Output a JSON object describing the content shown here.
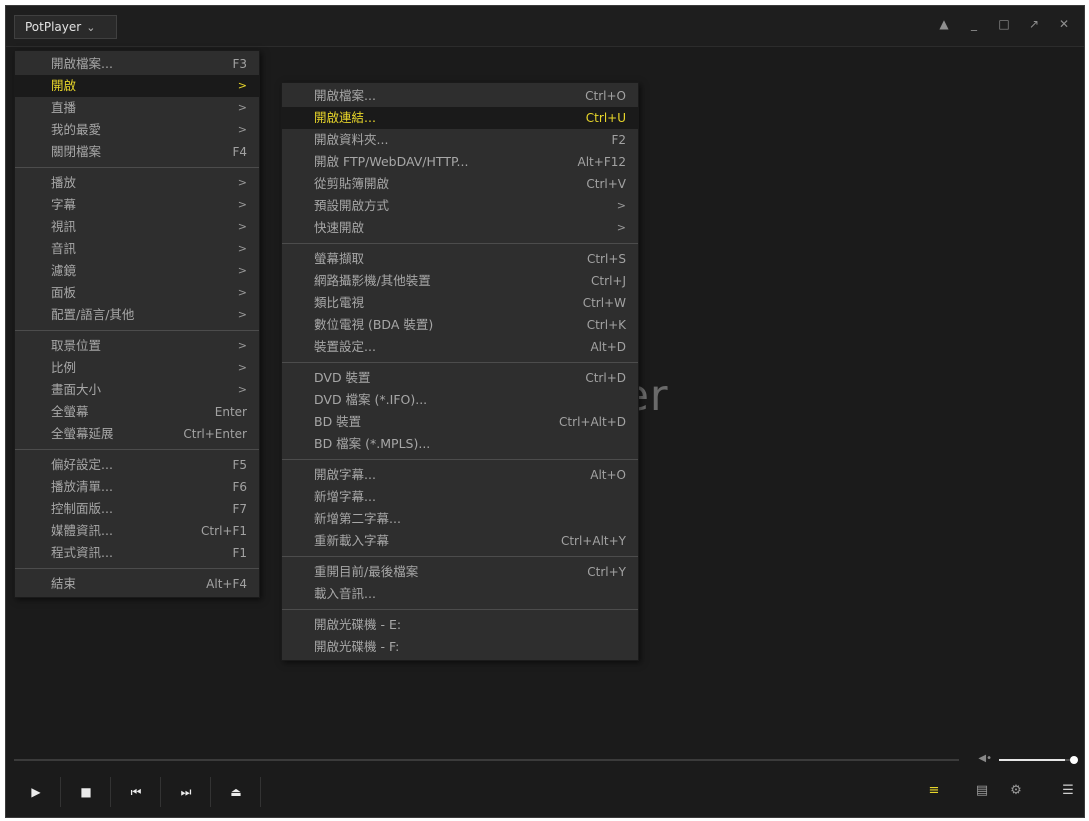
{
  "title_bar": {
    "app_menu_label": "PotPlayer",
    "window_controls": [
      "pin-icon",
      "minimize-icon",
      "maximize-icon",
      "fullscreen-icon",
      "close-icon"
    ]
  },
  "video": {
    "logo_text": "yer"
  },
  "main_menu": {
    "groups": [
      [
        {
          "label": "開啟檔案...",
          "shortcut": "F3",
          "submenu": false,
          "active": false
        },
        {
          "label": "開啟",
          "shortcut": "",
          "submenu": true,
          "active": true
        },
        {
          "label": "直播",
          "shortcut": "",
          "submenu": true,
          "active": false
        },
        {
          "label": "我的最愛",
          "shortcut": "",
          "submenu": true,
          "active": false
        },
        {
          "label": "關閉檔案",
          "shortcut": "F4",
          "submenu": false,
          "active": false
        }
      ],
      [
        {
          "label": "播放",
          "shortcut": "",
          "submenu": true,
          "active": false
        },
        {
          "label": "字幕",
          "shortcut": "",
          "submenu": true,
          "active": false
        },
        {
          "label": "視訊",
          "shortcut": "",
          "submenu": true,
          "active": false
        },
        {
          "label": "音訊",
          "shortcut": "",
          "submenu": true,
          "active": false
        },
        {
          "label": "濾鏡",
          "shortcut": "",
          "submenu": true,
          "active": false
        },
        {
          "label": "面板",
          "shortcut": "",
          "submenu": true,
          "active": false
        },
        {
          "label": "配置/語言/其他",
          "shortcut": "",
          "submenu": true,
          "active": false
        }
      ],
      [
        {
          "label": "取景位置",
          "shortcut": "",
          "submenu": true,
          "active": false
        },
        {
          "label": "比例",
          "shortcut": "",
          "submenu": true,
          "active": false
        },
        {
          "label": "畫面大小",
          "shortcut": "",
          "submenu": true,
          "active": false
        },
        {
          "label": "全螢幕",
          "shortcut": "Enter",
          "submenu": false,
          "active": false
        },
        {
          "label": "全螢幕延展",
          "shortcut": "Ctrl+Enter",
          "submenu": false,
          "active": false
        }
      ],
      [
        {
          "label": "偏好設定...",
          "shortcut": "F5",
          "submenu": false,
          "active": false
        },
        {
          "label": "播放清單...",
          "shortcut": "F6",
          "submenu": false,
          "active": false
        },
        {
          "label": "控制面版...",
          "shortcut": "F7",
          "submenu": false,
          "active": false
        },
        {
          "label": "媒體資訊...",
          "shortcut": "Ctrl+F1",
          "submenu": false,
          "active": false
        },
        {
          "label": "程式資訊...",
          "shortcut": "F1",
          "submenu": false,
          "active": false
        }
      ],
      [
        {
          "label": "結束",
          "shortcut": "Alt+F4",
          "submenu": false,
          "active": false
        }
      ]
    ]
  },
  "open_submenu": {
    "groups": [
      [
        {
          "label": "開啟檔案...",
          "shortcut": "Ctrl+O",
          "submenu": false,
          "active": false
        },
        {
          "label": "開啟連結...",
          "shortcut": "Ctrl+U",
          "submenu": false,
          "active": true
        },
        {
          "label": "開啟資料夾...",
          "shortcut": "F2",
          "submenu": false,
          "active": false
        },
        {
          "label": "開啟 FTP/WebDAV/HTTP...",
          "shortcut": "Alt+F12",
          "submenu": false,
          "active": false
        },
        {
          "label": "從剪貼簿開啟",
          "shortcut": "Ctrl+V",
          "submenu": false,
          "active": false
        },
        {
          "label": "預設開啟方式",
          "shortcut": "",
          "submenu": true,
          "active": false
        },
        {
          "label": "快速開啟",
          "shortcut": "",
          "submenu": true,
          "active": false
        }
      ],
      [
        {
          "label": "螢幕擷取",
          "shortcut": "Ctrl+S",
          "submenu": false,
          "active": false
        },
        {
          "label": "網路攝影機/其他裝置",
          "shortcut": "Ctrl+J",
          "submenu": false,
          "active": false
        },
        {
          "label": "類比電視",
          "shortcut": "Ctrl+W",
          "submenu": false,
          "active": false
        },
        {
          "label": "數位電視 (BDA 裝置)",
          "shortcut": "Ctrl+K",
          "submenu": false,
          "active": false
        },
        {
          "label": "裝置設定...",
          "shortcut": "Alt+D",
          "submenu": false,
          "active": false
        }
      ],
      [
        {
          "label": "DVD 裝置",
          "shortcut": "Ctrl+D",
          "submenu": false,
          "active": false
        },
        {
          "label": "DVD 檔案 (*.IFO)...",
          "shortcut": "",
          "submenu": false,
          "active": false
        },
        {
          "label": "BD 裝置",
          "shortcut": "Ctrl+Alt+D",
          "submenu": false,
          "active": false
        },
        {
          "label": "BD 檔案 (*.MPLS)...",
          "shortcut": "",
          "submenu": false,
          "active": false
        }
      ],
      [
        {
          "label": "開啟字幕...",
          "shortcut": "Alt+O",
          "submenu": false,
          "active": false
        },
        {
          "label": "新增字幕...",
          "shortcut": "",
          "submenu": false,
          "active": false
        },
        {
          "label": "新增第二字幕...",
          "shortcut": "",
          "submenu": false,
          "active": false
        },
        {
          "label": "重新載入字幕",
          "shortcut": "Ctrl+Alt+Y",
          "submenu": false,
          "active": false
        }
      ],
      [
        {
          "label": "重開目前/最後檔案",
          "shortcut": "Ctrl+Y",
          "submenu": false,
          "active": false
        },
        {
          "label": "載入音訊...",
          "shortcut": "",
          "submenu": false,
          "active": false
        }
      ],
      [
        {
          "label": "開啟光碟機 - E:",
          "shortcut": "",
          "submenu": false,
          "active": false
        },
        {
          "label": "開啟光碟機 - F:",
          "shortcut": "",
          "submenu": false,
          "active": false
        }
      ]
    ]
  },
  "playback": {
    "volume_level": 0.88,
    "controls": [
      "play-icon",
      "stop-icon",
      "previous-icon",
      "next-icon",
      "eject-icon"
    ],
    "right_controls": [
      "playlist-search-icon",
      "playlist-icon",
      "settings-icon",
      "menu-icon"
    ]
  },
  "colors": {
    "active_text": "#e8d62a",
    "menu_bg": "#2e2e2e",
    "window_bg": "#1b1b1b"
  }
}
